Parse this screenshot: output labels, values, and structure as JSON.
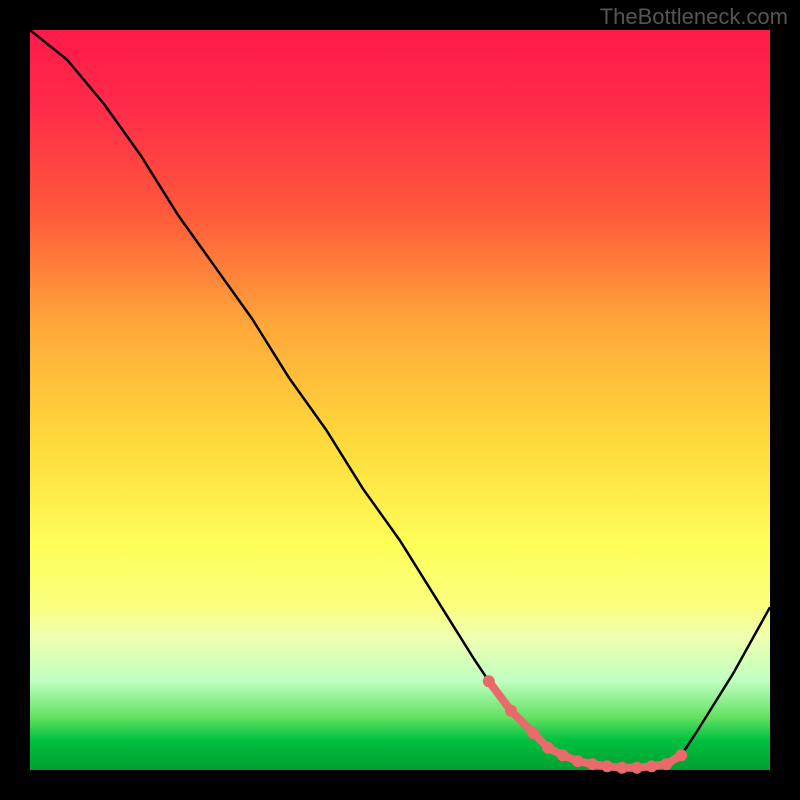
{
  "watermark": "TheBottleneck.com",
  "chart_data": {
    "type": "line",
    "title": "",
    "xlabel": "",
    "ylabel": "",
    "xlim": [
      0,
      100
    ],
    "ylim": [
      0,
      100
    ],
    "series": [
      {
        "name": "bottleneck-curve",
        "x": [
          0,
          5,
          10,
          15,
          20,
          25,
          30,
          35,
          40,
          45,
          50,
          55,
          60,
          62,
          65,
          68,
          70,
          72,
          74,
          76,
          78,
          80,
          82,
          84,
          86,
          88,
          90,
          95,
          100
        ],
        "y": [
          100,
          96,
          90,
          83,
          75,
          68,
          61,
          53,
          46,
          38,
          31,
          23,
          15,
          12,
          8,
          5,
          3,
          2,
          1.2,
          0.8,
          0.5,
          0.3,
          0.3,
          0.5,
          0.8,
          2,
          5,
          13,
          22
        ]
      }
    ],
    "markers": {
      "name": "highlighted-range",
      "color": "#e86a6a",
      "x": [
        62,
        65,
        68,
        70,
        72,
        74,
        76,
        78,
        80,
        82,
        84,
        86,
        88
      ],
      "y": [
        12,
        8,
        5,
        3,
        2,
        1.2,
        0.8,
        0.5,
        0.3,
        0.3,
        0.5,
        0.8,
        2
      ]
    }
  }
}
